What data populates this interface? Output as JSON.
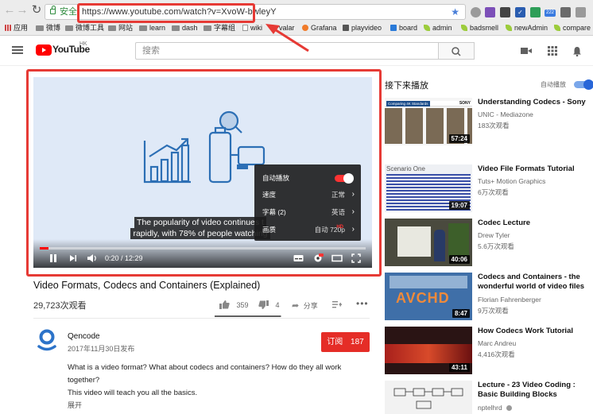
{
  "browser": {
    "url_secure_label": "安全",
    "url": "https://www.youtube.com/watch?v=XvoW-bwleyY",
    "ext_badge": "222",
    "bookmarks": [
      {
        "label": "应用",
        "type": "apps"
      },
      {
        "label": "微博",
        "type": "folder"
      },
      {
        "label": "微博工具",
        "type": "folder"
      },
      {
        "label": "网站",
        "type": "folder"
      },
      {
        "label": "learn",
        "type": "folder"
      },
      {
        "label": "dash",
        "type": "folder"
      },
      {
        "label": "字幕组",
        "type": "folder"
      },
      {
        "label": "wiki",
        "type": "page"
      },
      {
        "label": "valar",
        "type": "leaf"
      },
      {
        "label": "Grafana",
        "type": "grafana"
      },
      {
        "label": "playvideo",
        "type": "image"
      },
      {
        "label": "board",
        "type": "board"
      },
      {
        "label": "admin",
        "type": "leaf"
      },
      {
        "label": "badsmell",
        "type": "leaf"
      },
      {
        "label": "newAdmin",
        "type": "leaf"
      },
      {
        "label": "compare",
        "type": "leaf"
      }
    ]
  },
  "youtube_header": {
    "logo_text": "YouTube",
    "region": "HK",
    "search_placeholder": "搜索"
  },
  "player": {
    "caption_line1": "The popularity of video continues t",
    "caption_line2": "rapidly, with 78% of people watching",
    "time": "0:20 / 12:29",
    "progress_fraction": 0.027,
    "settings": {
      "autoplay_label": "自动播放",
      "speed_label": "速度",
      "speed_value": "正常",
      "subtitles_label": "字幕 (2)",
      "subtitles_value": "英语",
      "quality_label": "画质",
      "quality_value": "自动 720p",
      "quality_badge": "HD"
    }
  },
  "video": {
    "title": "Video Formats, Codecs and Containers (Explained)",
    "views": "29,723次观看",
    "likes": "359",
    "dislikes": "4",
    "share_label": "分享",
    "like_fraction": 0.99,
    "channel": "Qencode",
    "published": "2017年11月30日发布",
    "subscribe_label": "订阅",
    "subscriber_count": "187",
    "description_line1": "What is a video format? What about codecs and containers? How do they all work together?",
    "description_line2": "This video will teach you all the basics.",
    "show_more": "展开"
  },
  "sidebar": {
    "up_next_label": "接下来播放",
    "autoplay_label": "自动播放",
    "items": [
      {
        "title": "Understanding Codecs - Sony",
        "channel": "UNIC - Mediazone",
        "views": "183次观看",
        "duration": "57:24"
      },
      {
        "title": "Video File Formats Tutorial",
        "channel": "Tuts+ Motion Graphics",
        "views": "6万次观看",
        "duration": "19:07"
      },
      {
        "title": "Codec Lecture",
        "channel": "Drew Tyler",
        "views": "5.6万次观看",
        "duration": "40:06"
      },
      {
        "title": "Codecs and Containers - the wonderful world of video files",
        "channel": "Florian Fahrenberger",
        "views": "9万次观看",
        "duration": "8:47"
      },
      {
        "title": "How Codecs Work Tutorial",
        "channel": "Marc Andreu",
        "views": "4,416次观看",
        "duration": "43:11"
      },
      {
        "title": "Lecture - 23 Video Coding : Basic Building Blocks",
        "channel": "nptelhrd",
        "views": "",
        "duration": ""
      }
    ]
  },
  "thumb_texts": {
    "sony_banner": "Comparing 4K Standards",
    "sony_logo": "SONY",
    "scenario": "Scenario One",
    "avchd": "AVCHD"
  },
  "colors": {
    "annotation_red": "#e63a35",
    "youtube_red": "#ff0000",
    "subscribe_red": "#e52d27",
    "player_bg": "#dfe9f7",
    "illustration_blue": "#2c6fb5"
  }
}
